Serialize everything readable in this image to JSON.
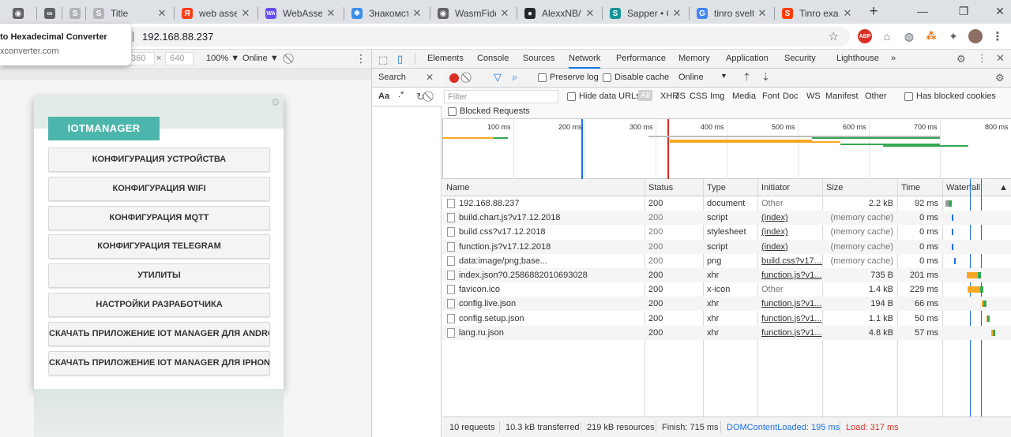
{
  "tabs": [
    {
      "title": "",
      "close": "✕",
      "favicon": "globe-icon",
      "fav_color": "#5f6368"
    },
    {
      "title": "",
      "close": "✕",
      "favicon": "infinity-icon",
      "fav_color": "#5f6368"
    },
    {
      "title": "",
      "close": "✕",
      "favicon": "s-logo-icon",
      "fav_color": "#b0b4b8"
    },
    {
      "title": "Title",
      "close": "✕",
      "favicon": "s-logo-icon",
      "fav_color": "#b0b4b8"
    },
    {
      "title": "web assem",
      "close": "✕",
      "favicon": "yandex-icon",
      "fav_color": "#fc3f1d"
    },
    {
      "title": "WebAssem",
      "close": "✕",
      "favicon": "wa-icon",
      "fav_color": "#654ff0"
    },
    {
      "title": "Знакомств",
      "close": "✕",
      "favicon": "puzzle-icon",
      "fav_color": "#3b8eea"
    },
    {
      "title": "WasmFiddl",
      "close": "✕",
      "favicon": "globe-icon",
      "fav_color": "#5f6368"
    },
    {
      "title": "AlexxNB/tin",
      "close": "✕",
      "favicon": "github-icon",
      "fav_color": "#24292e"
    },
    {
      "title": "Sapper • C",
      "close": "✕",
      "favicon": "sapper-icon",
      "fav_color": "#159497"
    },
    {
      "title": "tinro svelte",
      "close": "✕",
      "favicon": "google-icon",
      "fav_color": "#4285f4"
    },
    {
      "title": "Tinro exam",
      "close": "✕",
      "favicon": "svelte-icon",
      "fav_color": "#ff3e00"
    }
  ],
  "window": {
    "new_tab": "+",
    "minimize": "—",
    "restore": "❐",
    "close": "✕"
  },
  "omnibox": {
    "url": "192.168.88.237"
  },
  "popup": {
    "title": "to Hexadecimal Converter",
    "subtitle": "xconverter.com"
  },
  "device_toolbar": {
    "width": "360",
    "x": "×",
    "height": "640",
    "zoom": "100% ▼",
    "throttle": "Online ▼"
  },
  "app": {
    "brand": "IOTMANAGER",
    "menu": [
      "КОНФИГУРАЦИЯ УСТРОЙСТВА",
      "КОНФИГУРАЦИЯ WIFI",
      "КОНФИГУРАЦИЯ MQTT",
      "КОНФИГУРАЦИЯ TELEGRAM",
      "УТИЛИТЫ",
      "НАСТРОЙКИ РАЗРАБОТЧИКА",
      "СКАЧАТЬ ПРИЛОЖЕНИЕ IOT MANAGER ДЛЯ ANDROID",
      "СКАЧАТЬ ПРИЛОЖЕНИЕ IOT MANAGER ДЛЯ IPHONE"
    ]
  },
  "devtools": {
    "tabs": [
      "Elements",
      "Console",
      "Sources",
      "Network",
      "Performance",
      "Memory",
      "Application",
      "Security",
      "Lighthouse"
    ],
    "active_tab": "Network",
    "more": "»",
    "search_label": "Search",
    "preserve_log": "Preserve log",
    "disable_cache": "Disable cache",
    "throttle": "Online",
    "filter_placeholder": "Filter",
    "hide_data_urls": "Hide data URLs",
    "filter_types": [
      "All",
      "XHR",
      "JS",
      "CSS",
      "Img",
      "Media",
      "Font",
      "Doc",
      "WS",
      "Manifest",
      "Other"
    ],
    "has_blocked_cookies": "Has blocked cookies",
    "blocked_requests": "Blocked Requests",
    "overview_ticks": [
      "100 ms",
      "200 ms",
      "300 ms",
      "400 ms",
      "500 ms",
      "600 ms",
      "700 ms",
      "800 ms"
    ],
    "columns": [
      "Name",
      "Status",
      "Type",
      "Initiator",
      "Size",
      "Time",
      "Waterfall"
    ],
    "requests": [
      {
        "name": "192.168.88.237",
        "status": "200",
        "type": "document",
        "initiator": "Other",
        "size": "2.2 kB",
        "time": "92 ms",
        "wf_start": 0.0,
        "wf_wait": 0.005,
        "wf_recv": 0.087
      },
      {
        "name": "build.chart.js?v17.12.2018",
        "status": "200",
        "type": "script",
        "initiator": "(index)",
        "size": "(memory cache)",
        "time": "0 ms",
        "wf_start": 0.095,
        "wf_wait": 0,
        "wf_recv": 0.004
      },
      {
        "name": "build.css?v17.12.2018",
        "status": "200",
        "type": "stylesheet",
        "initiator": "(index)",
        "size": "(memory cache)",
        "time": "0 ms",
        "wf_start": 0.095,
        "wf_wait": 0,
        "wf_recv": 0.004
      },
      {
        "name": "function.js?v17.12.2018",
        "status": "200",
        "type": "script",
        "initiator": "(index)",
        "size": "(memory cache)",
        "time": "0 ms",
        "wf_start": 0.095,
        "wf_wait": 0,
        "wf_recv": 0.004
      },
      {
        "name": "data:image/png;base...",
        "status": "200",
        "type": "png",
        "initiator": "build.css?v17....",
        "size": "(memory cache)",
        "time": "0 ms",
        "wf_start": 0.128,
        "wf_wait": 0,
        "wf_recv": 0.004
      },
      {
        "name": "index.json?0.2586882010693028",
        "status": "200",
        "type": "xhr",
        "initiator": "function.js?v1...",
        "size": "735 B",
        "time": "201 ms",
        "wf_start": 0.31,
        "wf_wait": 0.155,
        "wf_recv": 0.046
      },
      {
        "name": "favicon.ico",
        "status": "200",
        "type": "x-icon",
        "initiator": "Other",
        "size": "1.4 kB",
        "time": "229 ms",
        "wf_start": 0.315,
        "wf_wait": 0.185,
        "wf_recv": 0.044
      },
      {
        "name": "config.live.json",
        "status": "200",
        "type": "xhr",
        "initiator": "function.js?v1...",
        "size": "194 B",
        "time": "66 ms",
        "wf_start": 0.52,
        "wf_wait": 0.03,
        "wf_recv": 0.036
      },
      {
        "name": "config.setup.json",
        "status": "200",
        "type": "xhr",
        "initiator": "function.js?v1...",
        "size": "1.1 kB",
        "time": "50 ms",
        "wf_start": 0.59,
        "wf_wait": 0.015,
        "wf_recv": 0.035
      },
      {
        "name": "lang.ru.json",
        "status": "200",
        "type": "xhr",
        "initiator": "function.js?v1...",
        "size": "4.8 kB",
        "time": "57 ms",
        "wf_start": 0.66,
        "wf_wait": 0.02,
        "wf_recv": 0.037
      }
    ],
    "status": {
      "requests": "10 requests",
      "transferred": "10.3 kB transferred",
      "resources": "219 kB resources",
      "finish": "Finish: 715 ms",
      "dcl": "DOMContentLoaded: 195 ms",
      "load": "Load: 317 ms"
    },
    "colors": {
      "wait": "#f9a825",
      "recv": "#34a853",
      "dcl": "#1a73e8",
      "load": "#d93025",
      "active": "#1a73e8",
      "record": "#d93025"
    }
  }
}
